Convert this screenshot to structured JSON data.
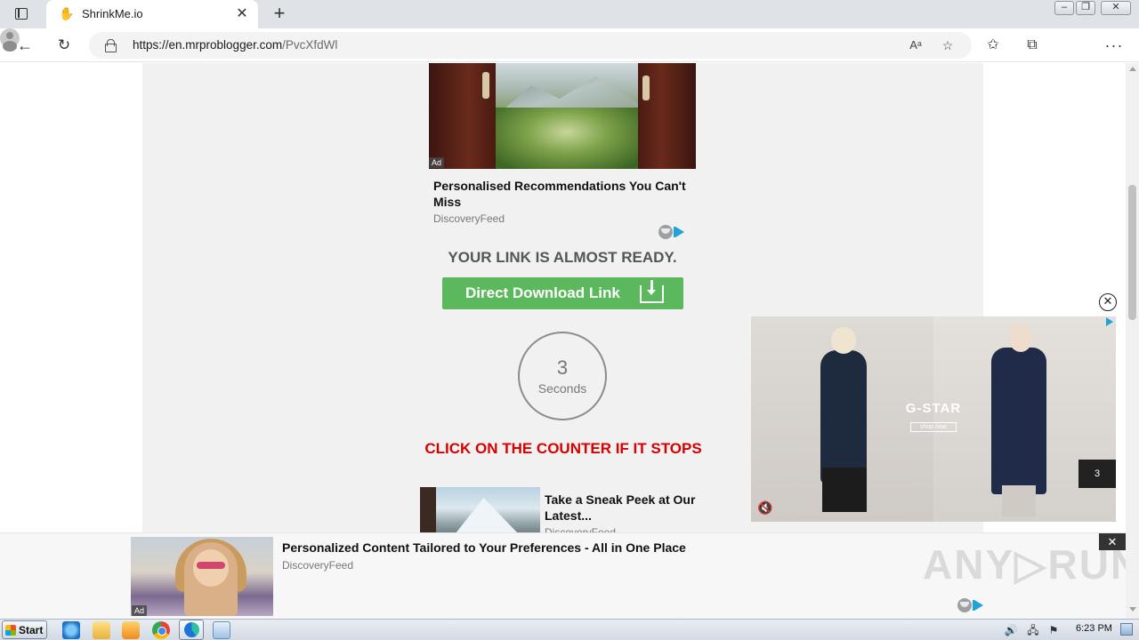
{
  "browser": {
    "tab_title": "ShrinkMe.io",
    "tab_close": "✕",
    "new_tab": "+",
    "url_host": "https://en.mrproblogger.com",
    "url_path": "/PvcXfdWl",
    "window_controls": {
      "minimize": "–",
      "maximize": "❐",
      "close": "✕"
    },
    "icons": [
      "tab-actions-icon",
      "back-icon",
      "reload-icon",
      "lock-icon",
      "read-aloud-icon",
      "add-favorite-icon",
      "favorites-icon",
      "collections-icon",
      "profile-icon",
      "more-icon"
    ]
  },
  "page": {
    "ad_top": {
      "badge": "Ad",
      "headline": "Personalised Recommendations You Can't Miss",
      "source": "DiscoveryFeed"
    },
    "link_ready": "YOUR LINK IS ALMOST READY.",
    "download_button": "Direct Download Link",
    "counter": {
      "value": "3",
      "unit": "Seconds"
    },
    "click_counter": "CLICK ON THE COUNTER IF IT STOPS",
    "ad_middle": {
      "headline": "Take a Sneak Peek at Our Latest...",
      "source": "DiscoveryFeed"
    },
    "video_ad": {
      "brand": "G-STAR",
      "cta": "shop now",
      "timer": "3",
      "close": "✕"
    },
    "sticky_ad": {
      "badge": "Ad",
      "headline": "Personalized Content Tailored to Your Preferences - All in One Place",
      "source": "DiscoveryFeed",
      "close": "✕"
    },
    "watermark": "ANY▷RUN"
  },
  "taskbar": {
    "start_label": "Start",
    "clock": "6:23 PM"
  },
  "colors": {
    "download_green": "#5cb85c",
    "warning_red": "#d60000",
    "adchoices_blue": "#1fa4d8"
  }
}
